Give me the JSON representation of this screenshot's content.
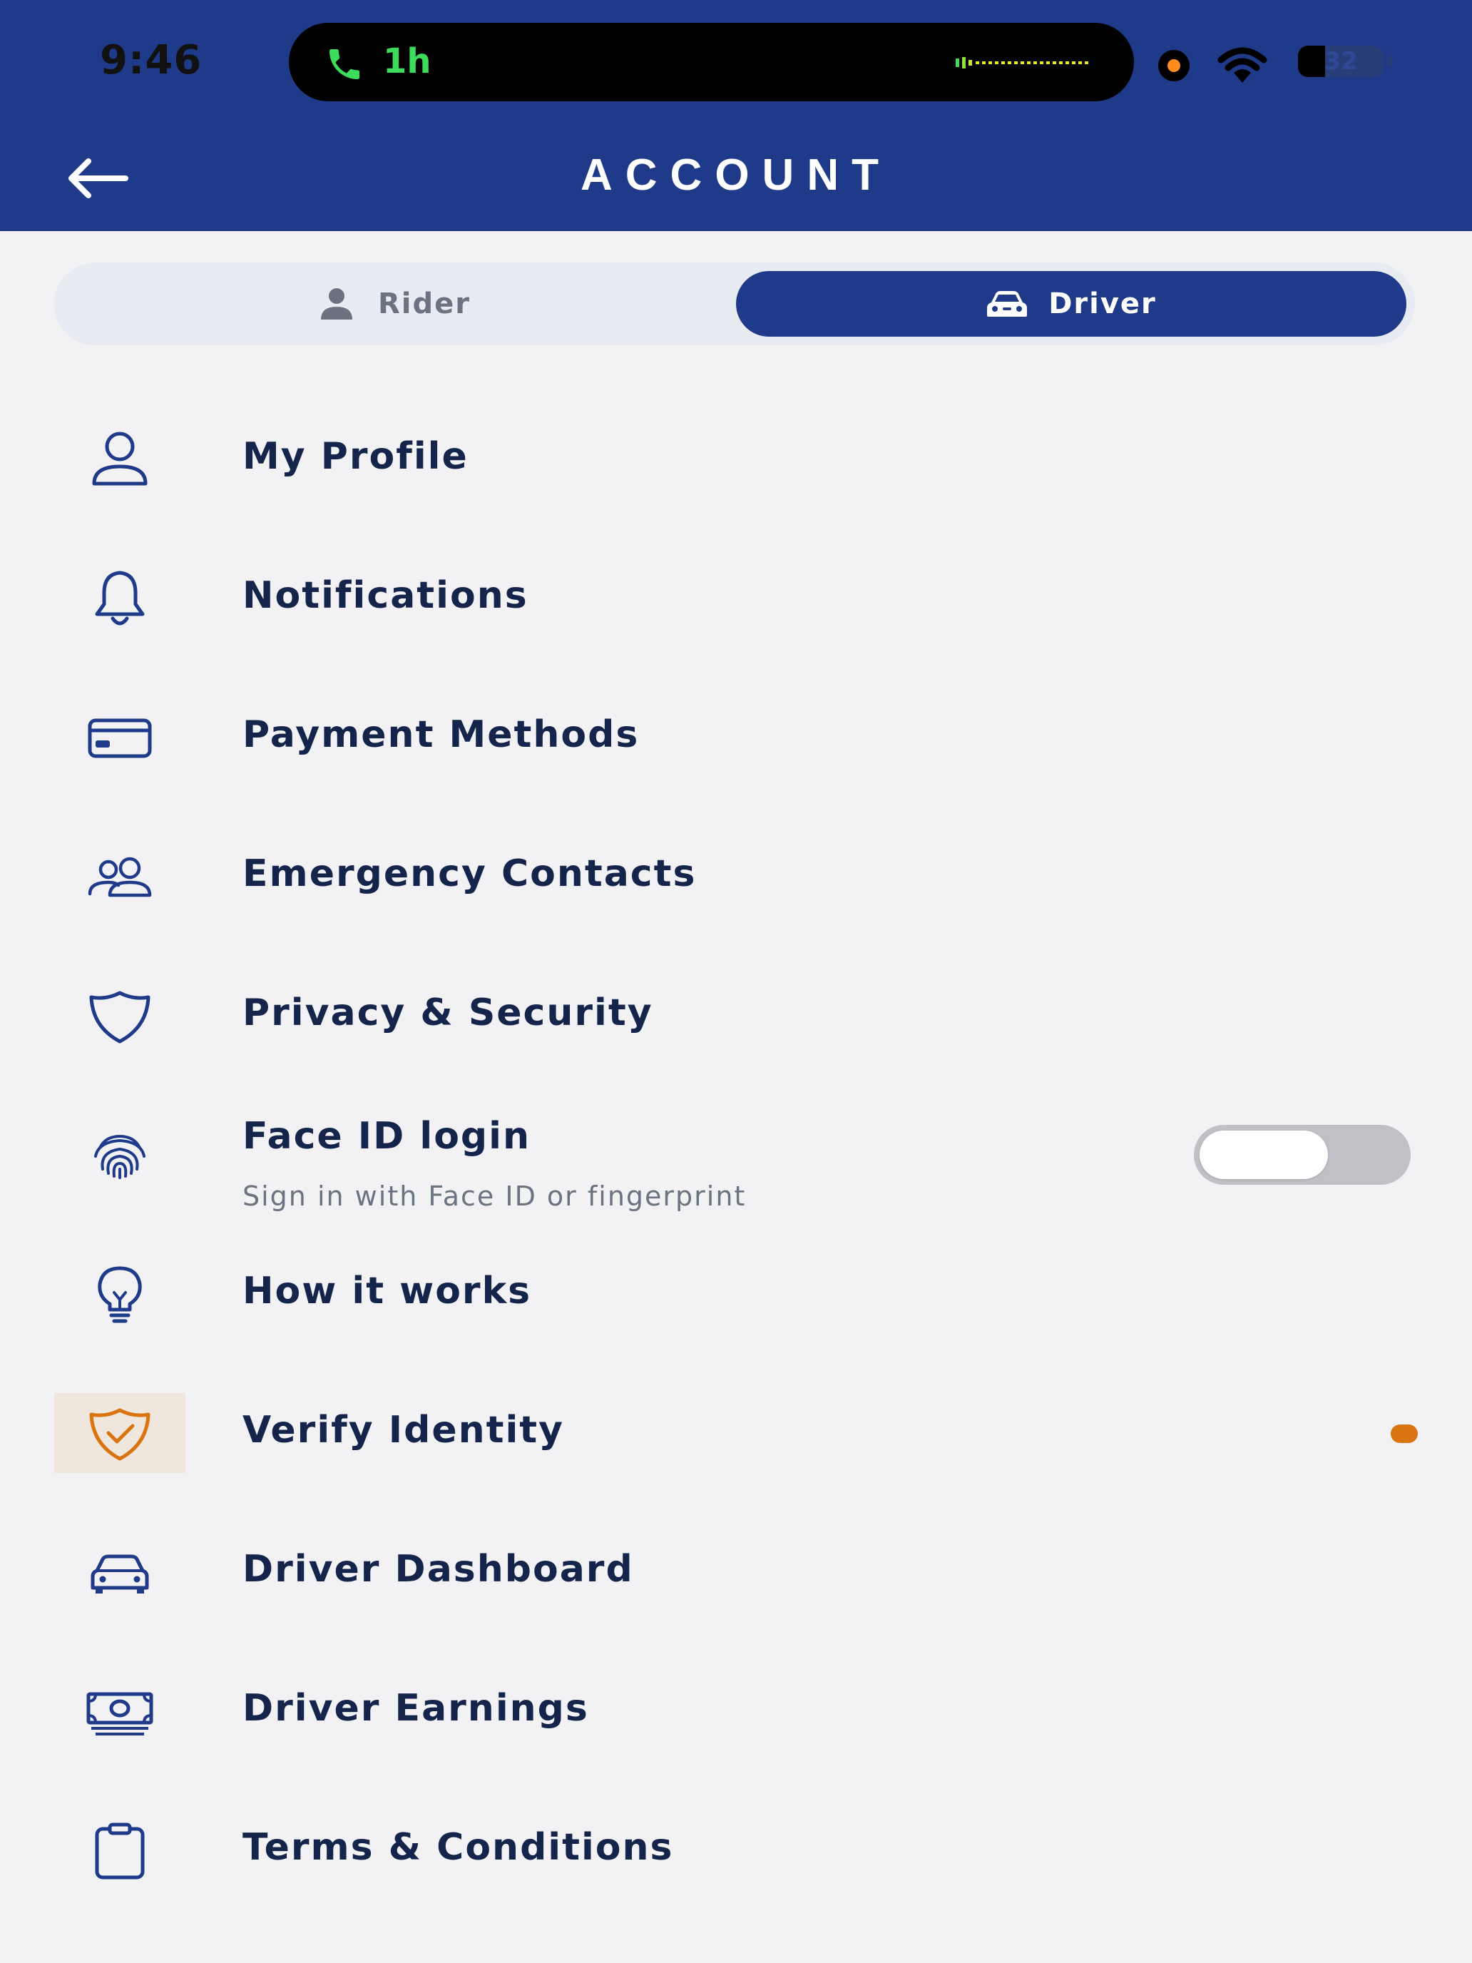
{
  "status_bar": {
    "time": "9:46",
    "call_duration": "1h",
    "battery_level": "32",
    "battery_fraction": 0.32
  },
  "header": {
    "title": "ACCOUNT",
    "back_icon": "arrow-left-icon"
  },
  "segment": {
    "rider_label": "Rider",
    "driver_label": "Driver",
    "selected": "Driver"
  },
  "menu": {
    "items": [
      {
        "label": "My Profile",
        "icon": "user-icon"
      },
      {
        "label": "Notifications",
        "icon": "bell-icon"
      },
      {
        "label": "Payment Methods",
        "icon": "credit-card-icon"
      },
      {
        "label": "Emergency Contacts",
        "icon": "users-icon"
      },
      {
        "label": "Privacy & Security",
        "icon": "shield-icon"
      },
      {
        "label": "Face ID login",
        "sublabel": "Sign in with Face ID or fingerprint",
        "icon": "fingerprint-icon",
        "toggle_on": false
      },
      {
        "label": "How it works",
        "icon": "lightbulb-icon"
      },
      {
        "label": "Verify Identity",
        "icon": "shield-check-icon",
        "alert": true
      },
      {
        "label": "Driver Dashboard",
        "icon": "car-icon"
      },
      {
        "label": "Driver Earnings",
        "icon": "cash-icon"
      },
      {
        "label": "Terms & Conditions",
        "icon": "clipboard-icon"
      }
    ]
  },
  "colors": {
    "header_bg": "#1f3a89",
    "text_primary": "#15244a",
    "accent_orange": "#d9740f",
    "background": "#f2f2f5"
  }
}
